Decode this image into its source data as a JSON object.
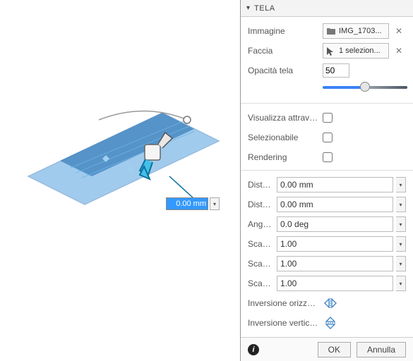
{
  "panel": {
    "title": "TELA",
    "image": {
      "label": "Immagine",
      "value": "IMG_1703..."
    },
    "face": {
      "label": "Faccia",
      "value": "1 selezion..."
    },
    "opacity": {
      "label": "Opacità tela",
      "value": "50"
    },
    "viewthrough": {
      "label": "Visualizza attravers..."
    },
    "selectable": {
      "label": "Selezionabile"
    },
    "rendering": {
      "label": "Rendering"
    },
    "dx": {
      "label": "Distanza X",
      "value": "0.00 mm"
    },
    "dy": {
      "label": "Distanza Y",
      "value": "0.00 mm"
    },
    "az": {
      "label": "Angolo Z",
      "value": "0.0 deg"
    },
    "sx": {
      "label": "Scala X",
      "value": "1.00"
    },
    "sy": {
      "label": "Scala Y",
      "value": "1.00"
    },
    "sxy": {
      "label": "Scala piano XY",
      "value": "1.00"
    },
    "fliph": {
      "label": "Inversione orizzont..."
    },
    "flipv": {
      "label": "Inversione verticale"
    }
  },
  "footer": {
    "ok": "OK",
    "cancel": "Annulla"
  },
  "canvas": {
    "dimension_value": "0.00 mm"
  }
}
